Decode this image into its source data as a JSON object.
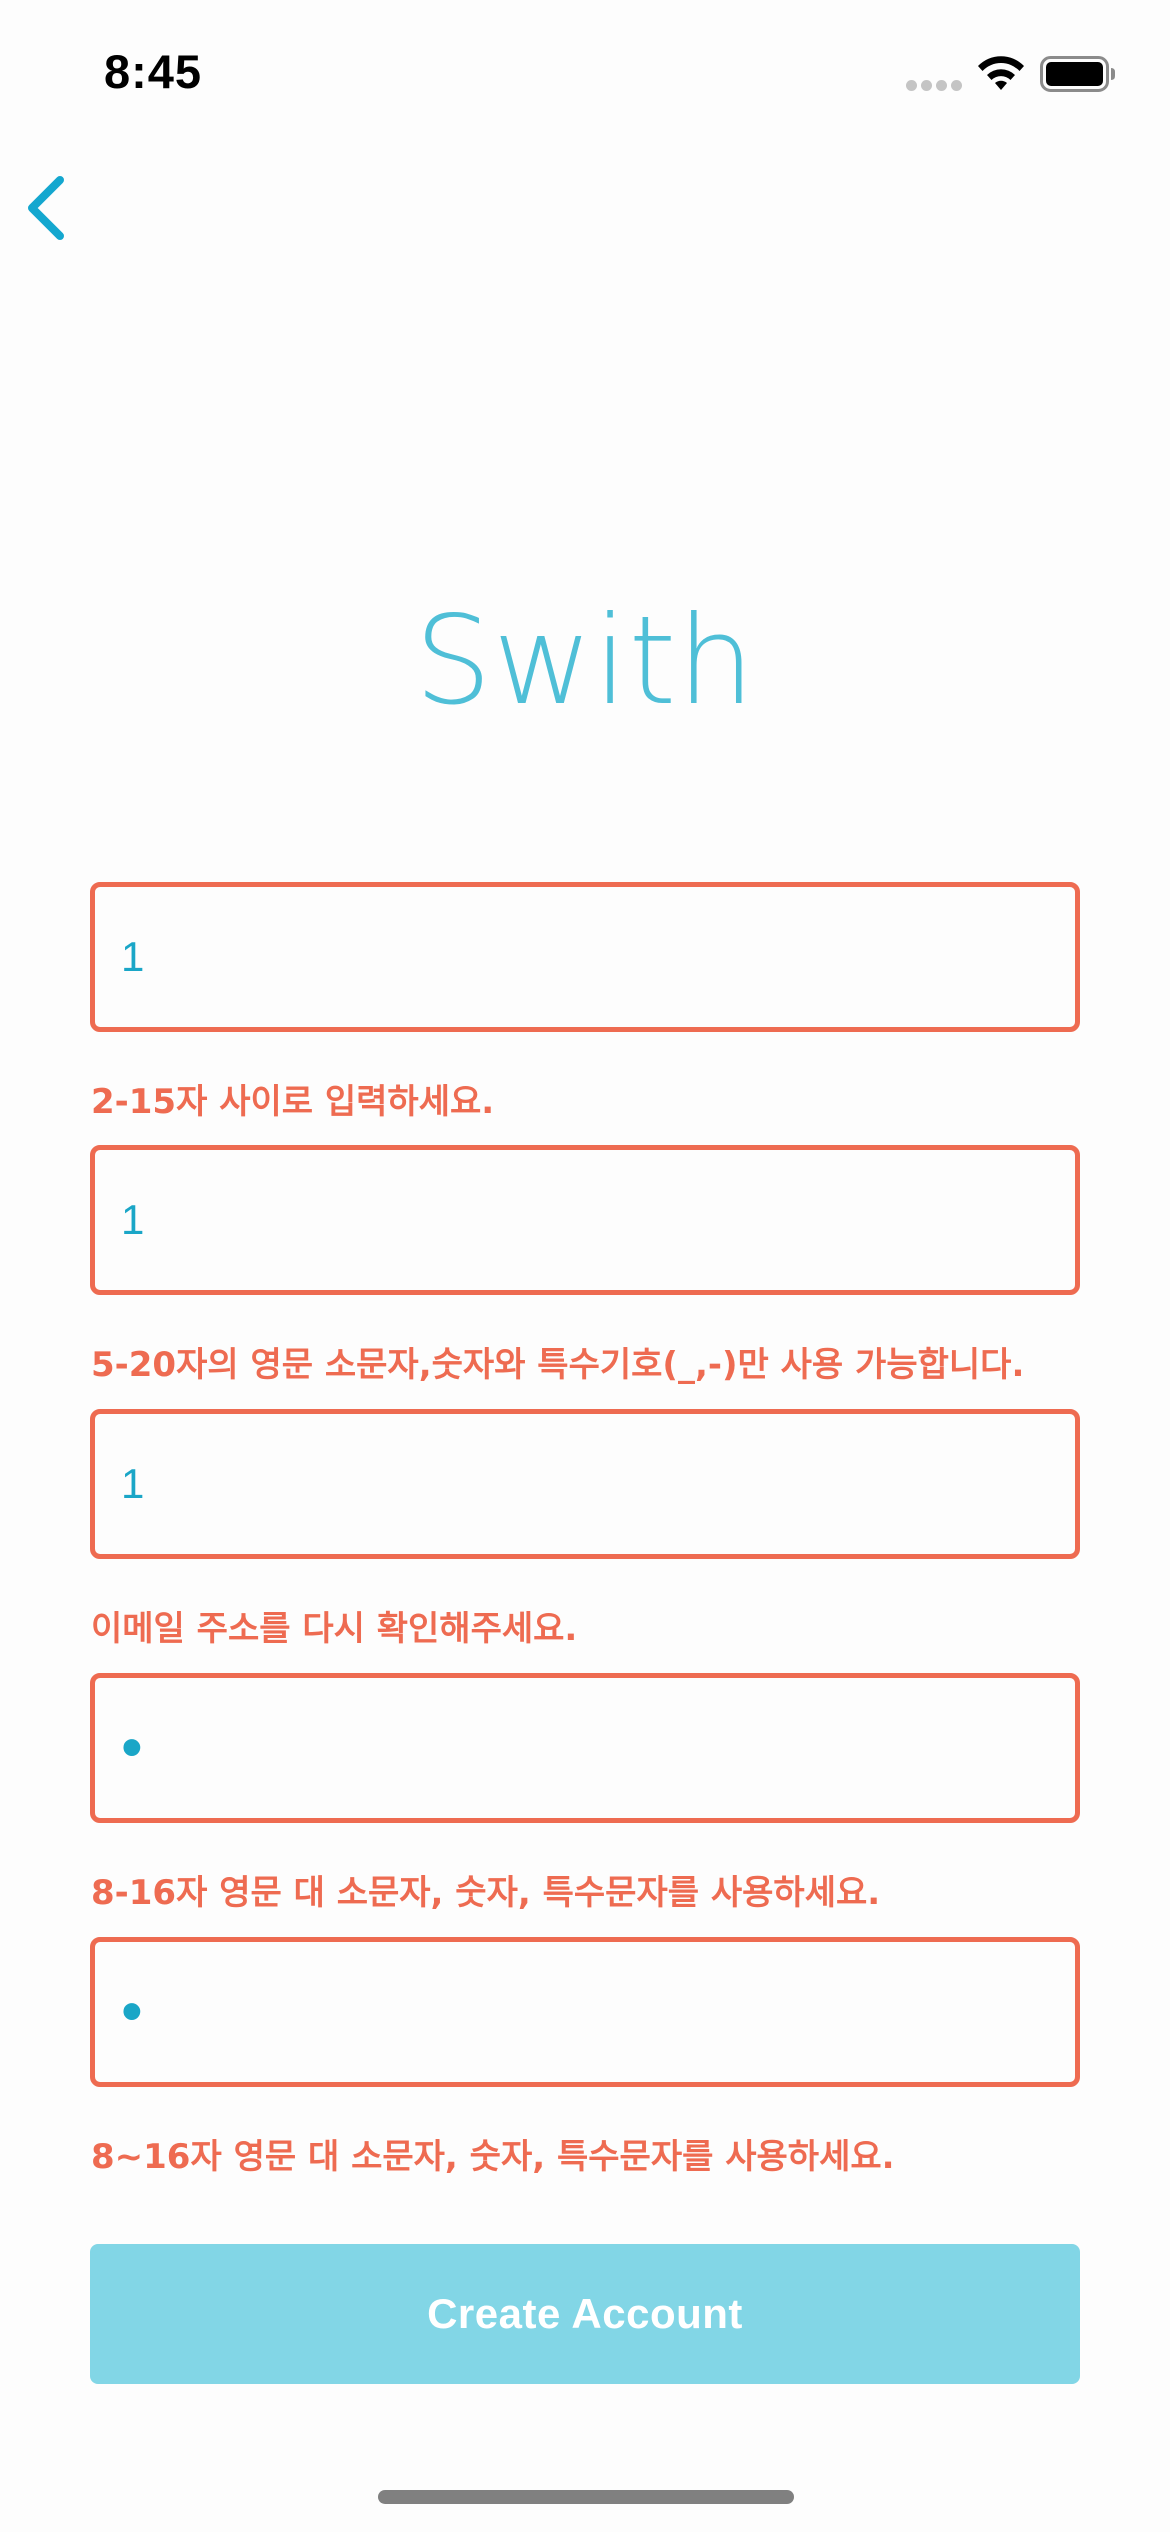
{
  "status_bar": {
    "time": "8:45"
  },
  "nav": {
    "back_icon": "chevron-left-icon"
  },
  "logo": {
    "text": "Swith",
    "color": "#46bcd6"
  },
  "form": {
    "fields": [
      {
        "value": "1",
        "error": "2-15자 사이로 입력하세요."
      },
      {
        "value": "1",
        "error": "5-20자의 영문 소문자,숫자와 특수기호(_,-)만 사용 가능합니다."
      },
      {
        "value": "1",
        "error": "이메일 주소를 다시 확인해주세요."
      },
      {
        "value": "•",
        "error": "8-16자 영문 대 소문자, 숫자, 특수문자를 사용하세요."
      },
      {
        "value": "•",
        "error": "8~16자 영문 대 소문자, 숫자, 특수문자를 사용하세요."
      }
    ],
    "submit_label": "Create Account"
  },
  "colors": {
    "error": "#ee6b51",
    "accent": "#1aa6c7",
    "button_bg": "#82d6e6"
  }
}
